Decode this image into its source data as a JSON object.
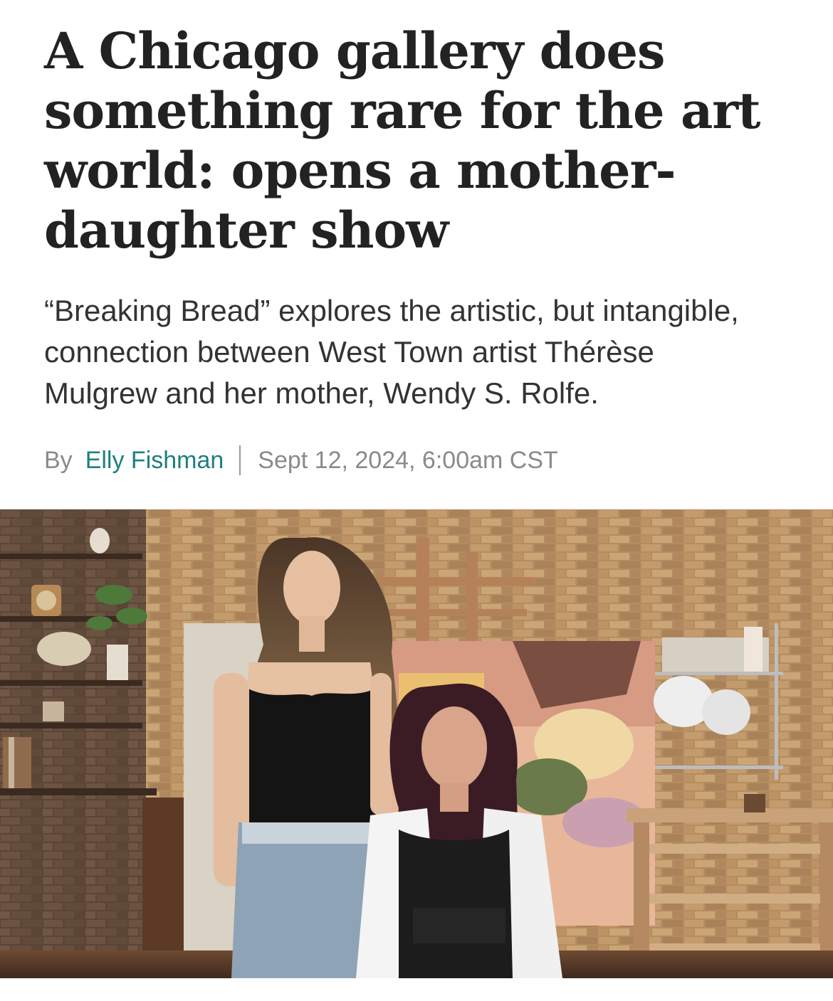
{
  "article": {
    "headline": "A Chicago gallery does something rare for the art world: opens a mother-daughter show",
    "dek": "“Breaking Bread” explores the artistic, but intangible, connection between West Town artist Thérèse Mulgrew and her mother, Wendy S. Rolfe.",
    "byline_prefix": "By",
    "author": "Elly Fishman",
    "date": "Sept 12, 2024, 6:00am CST"
  },
  "hero_image": {
    "subject": "Thérèse Mulgrew and Wendy S. Rolfe in an art studio with brick wall, easel, painting and shelves"
  },
  "colors": {
    "headline": "#222222",
    "dek": "#333333",
    "byline_muted": "#8a8a8a",
    "author_link": "#1f7f7f"
  }
}
